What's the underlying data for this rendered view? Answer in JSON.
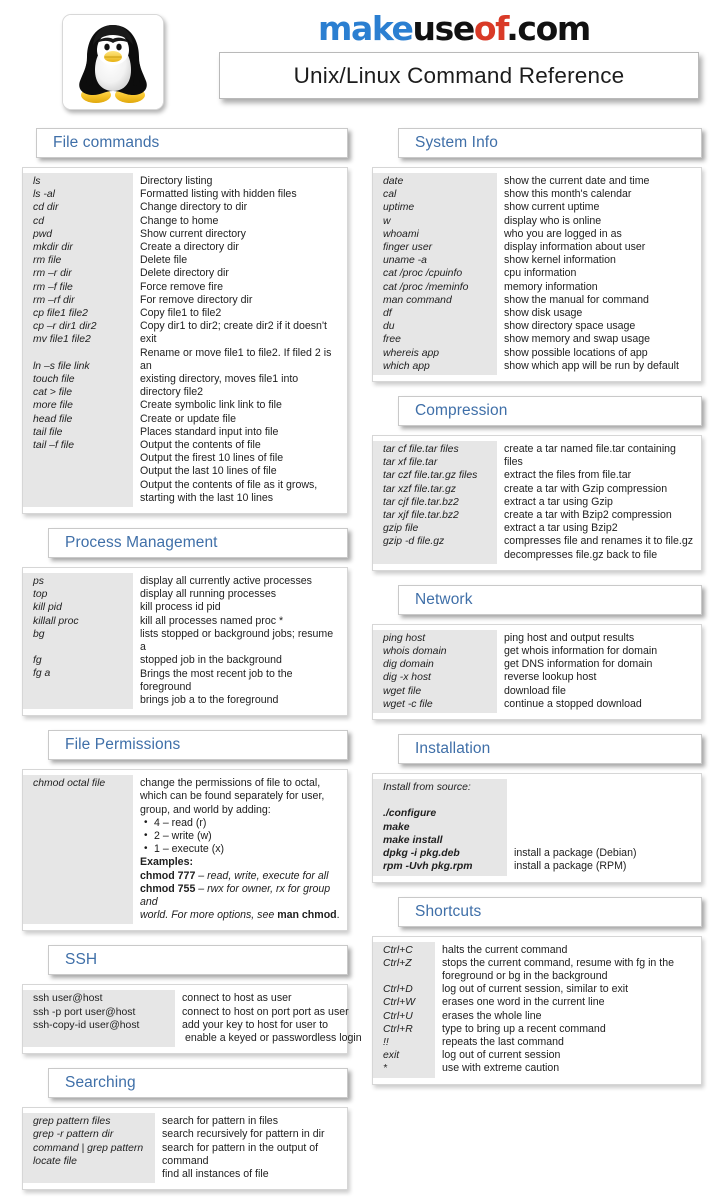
{
  "header": {
    "brand": {
      "make": "make",
      "use": "use",
      "of": "of",
      "com": ".com"
    },
    "title": "Unix/Linux Command Reference",
    "logo_icon": "linux-penguin-icon"
  },
  "sections": {
    "file_commands": {
      "title": "File commands",
      "rows": [
        {
          "cmd": "ls",
          "desc": "Directory listing"
        },
        {
          "cmd": "ls -al",
          "desc": "Formatted listing with hidden files"
        },
        {
          "cmd": "cd dir",
          "desc": "Change directory to dir"
        },
        {
          "cmd": "cd",
          "desc": "Change to home"
        },
        {
          "cmd": "pwd",
          "desc": "Show current directory"
        },
        {
          "cmd": "mkdir dir",
          "desc": "Create a directory dir"
        },
        {
          "cmd": "rm file",
          "desc": "Delete file"
        },
        {
          "cmd": "rm –r dir",
          "desc": "Delete directory dir"
        },
        {
          "cmd": "rm –f file",
          "desc": "Force remove fire"
        },
        {
          "cmd": "rm –rf dir",
          "desc": "For remove directory dir"
        },
        {
          "cmd": "cp file1 file2",
          "desc": "Copy file1 to file2"
        },
        {
          "cmd": "cp –r dir1 dir2",
          "desc": "Copy dir1 to dir2; create dir2 if it doesn't exit"
        },
        {
          "cmd": "mv file1 file2",
          "desc": "Rename or move file1 to file2. If filed 2 is an"
        },
        {
          "cmd": "",
          "desc": "existing directory, moves file1 into directory  file2"
        },
        {
          "cmd": "ln –s file link",
          "desc": "Create symbolic link link to file"
        },
        {
          "cmd": "touch file",
          "desc": "Create or update file"
        },
        {
          "cmd": "cat > file",
          "desc": "Places standard input into file"
        },
        {
          "cmd": "more file",
          "desc": "Output the contents of file"
        },
        {
          "cmd": "head file",
          "desc": "Output the firest 10 lines of file"
        },
        {
          "cmd": "tail file",
          "desc": "Output the last 10 lines of file"
        },
        {
          "cmd": "tail –f file",
          "desc": "Output the contents of file as it grows,"
        },
        {
          "cmd": "",
          "desc": "starting with the last 10 lines"
        }
      ]
    },
    "process_management": {
      "title": "Process Management",
      "rows": [
        {
          "cmd": "ps",
          "desc": "display all currently active processes"
        },
        {
          "cmd": "top",
          "desc": "display all running processes"
        },
        {
          "cmd": "kill pid",
          "desc": "kill process id pid"
        },
        {
          "cmd": "killall proc",
          "desc": "kill all processes named proc *"
        },
        {
          "cmd": "bg",
          "desc": "lists stopped or background jobs; resume a"
        },
        {
          "cmd": "",
          "desc": "stopped job in the background"
        },
        {
          "cmd": "fg",
          "desc": "Brings the most recent job to the foreground"
        },
        {
          "cmd": "fg a",
          "desc": "brings job a to the foreground"
        }
      ]
    },
    "file_permissions": {
      "title": "File Permissions",
      "cmd": "chmod octal file",
      "desc_lines": [
        "change the permissions of file to octal,",
        "which can be found separately for user,",
        "group, and world by adding:"
      ],
      "bullets": [
        "4 – read (r)",
        "2 – write (w)",
        "1 – execute (x)"
      ],
      "examples_label": "Examples:",
      "example_lines": [
        {
          "bold": "chmod 777",
          "rest": " – read, write, execute for all"
        },
        {
          "bold": "chmod 755",
          "rest": " – rwx for owner, rx for group and"
        }
      ],
      "example_tail_pre": "world. For more options, see ",
      "example_tail_bold": "man chmod",
      "example_tail_post": "."
    },
    "ssh": {
      "title": "SSH",
      "cmds": [
        "ssh user@host",
        "ssh -p port user@host",
        "ssh-copy-id user@host"
      ],
      "descs": [
        "connect to host as user",
        "connect to host on port port as user",
        "add your key to host for user to",
        " enable a keyed or passwordless login"
      ]
    },
    "searching": {
      "title": "Searching",
      "cmds": [
        "grep pattern files",
        "grep -r pattern dir",
        "command  | grep pattern",
        "locate file"
      ],
      "descs": [
        "search for pattern in files",
        "search recursively for pattern in dir",
        "search for pattern in the output of command",
        "find all instances of file"
      ]
    },
    "system_info": {
      "title": "System Info",
      "rows": [
        {
          "cmd": "date",
          "desc": "show the current date and time"
        },
        {
          "cmd": "cal",
          "desc": "show this month's calendar"
        },
        {
          "cmd": "uptime",
          "desc": "show current uptime"
        },
        {
          "cmd": "w",
          "desc": "display who is online"
        },
        {
          "cmd": "whoami",
          "desc": "who you are logged in as"
        },
        {
          "cmd": "finger user",
          "desc": "display information about user"
        },
        {
          "cmd": "uname -a",
          "desc": "show kernel information"
        },
        {
          "cmd": "cat /proc /cpuinfo",
          "desc": "cpu information"
        },
        {
          "cmd": "cat /proc /meminfo",
          "desc": "memory information"
        },
        {
          "cmd": "man command",
          "desc": "show the manual for command"
        },
        {
          "cmd": "df",
          "desc": "show disk usage"
        },
        {
          "cmd": "du",
          "desc": "show directory space usage"
        },
        {
          "cmd": "free",
          "desc": "show memory and swap usage"
        },
        {
          "cmd": "whereis app",
          "desc": "show possible locations of app"
        },
        {
          "cmd": "which app",
          "desc": "show which app will be run by default"
        }
      ]
    },
    "compression": {
      "title": "Compression",
      "rows": [
        {
          "cmd": "tar cf file.tar files",
          "desc": "create a tar named file.tar containing files"
        },
        {
          "cmd": "tar xf file.tar",
          "desc": "extract the files from file.tar"
        },
        {
          "cmd": "tar czf file.tar.gz files",
          "desc": "create a tar with Gzip compression"
        },
        {
          "cmd": "tar xzf file.tar.gz",
          "desc": "extract a tar using Gzip"
        },
        {
          "cmd": "tar cjf file.tar.bz2",
          "desc": "create a tar with Bzip2 compression"
        },
        {
          "cmd": "tar xjf file.tar.bz2",
          "desc": "extract a tar using Bzip2"
        },
        {
          "cmd": "gzip file",
          "desc": "compresses file and renames it to file.gz"
        },
        {
          "cmd": "gzip -d file.gz",
          "desc": "decompresses file.gz back to file"
        }
      ]
    },
    "network": {
      "title": "Network",
      "rows": [
        {
          "cmd": "ping host",
          "desc": "ping host and output results"
        },
        {
          "cmd": "whois domain",
          "desc": "get whois information for domain"
        },
        {
          "cmd": "dig domain",
          "desc": "get DNS information for domain"
        },
        {
          "cmd": "dig -x host",
          "desc": "reverse lookup host"
        },
        {
          "cmd": "wget file",
          "desc": "download file"
        },
        {
          "cmd": "wget -c file",
          "desc": "continue a stopped download"
        }
      ]
    },
    "installation": {
      "title": "Installation",
      "intro": "Install from source:",
      "rows": [
        {
          "cmd": "./configure",
          "desc": ""
        },
        {
          "cmd": "make",
          "desc": ""
        },
        {
          "cmd": "make install",
          "desc": ""
        },
        {
          "cmd": "dpkg -i pkg.deb",
          "desc": "install a package (Debian)"
        },
        {
          "cmd": "rpm -Uvh pkg.rpm",
          "desc": "install a package (RPM)"
        }
      ]
    },
    "shortcuts": {
      "title": "Shortcuts",
      "rows": [
        {
          "cmd": "Ctrl+C",
          "desc": "halts the current command"
        },
        {
          "cmd": "Ctrl+Z",
          "desc": "stops the current command, resume with fg in the"
        },
        {
          "cmd": "",
          "desc": "foreground or bg in the background"
        },
        {
          "cmd": "Ctrl+D",
          "desc": "log out of current session, similar to exit"
        },
        {
          "cmd": "Ctrl+W",
          "desc": "erases one word in the current line"
        },
        {
          "cmd": "Ctrl+U",
          "desc": "erases the whole line"
        },
        {
          "cmd": "Ctrl+R",
          "desc": "type to bring up a recent command"
        },
        {
          "cmd": "!!",
          "desc": "repeats the last command"
        },
        {
          "cmd": "exit",
          "desc": "log out of current session"
        },
        {
          "cmd": "*",
          "desc": "use with extreme caution"
        }
      ]
    }
  },
  "colors": {
    "heading": "#3f6fa8",
    "cmd_column_bg": "#e6e6e6",
    "brand_blue": "#2b7fd1",
    "brand_red": "#d93a27"
  }
}
